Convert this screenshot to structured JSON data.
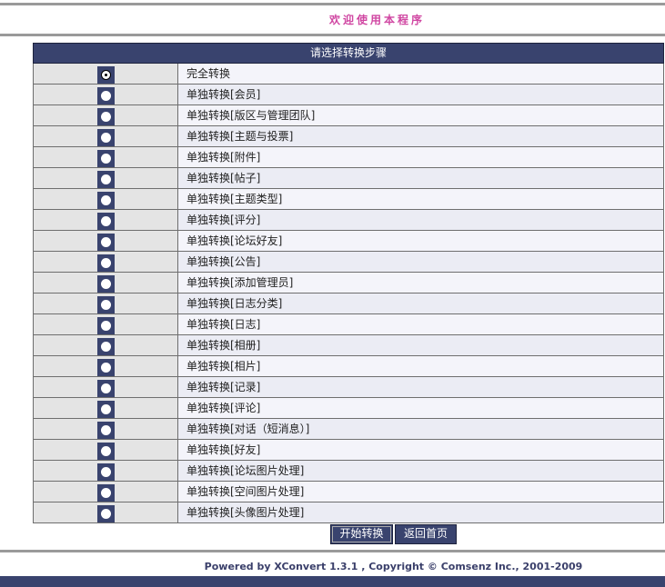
{
  "header": {
    "welcome_text": "欢迎使用本程序"
  },
  "table": {
    "title": "请选择转换步骤",
    "selected_index": 0,
    "options": [
      "完全转换",
      "单独转换[会员]",
      "单独转换[版区与管理团队]",
      "单独转换[主题与投票]",
      "单独转换[附件]",
      "单独转换[帖子]",
      "单独转换[主题类型]",
      "单独转换[评分]",
      "单独转换[论坛好友]",
      "单独转换[公告]",
      "单独转换[添加管理员]",
      "单独转换[日志分类]",
      "单独转换[日志]",
      "单独转换[相册]",
      "单独转换[相片]",
      "单独转换[记录]",
      "单独转换[评论]",
      "单独转换[对话（短消息）]",
      "单独转换[好友]",
      "单独转换[论坛图片处理]",
      "单独转换[空间图片处理]",
      "单独转换[头像图片处理]"
    ]
  },
  "buttons": {
    "start_label": "开始转换",
    "home_label": "返回首页"
  },
  "footer": {
    "text": "Powered by XConvert 1.3.1 ,  Copyright © Comsenz Inc., 2001-2009"
  }
}
